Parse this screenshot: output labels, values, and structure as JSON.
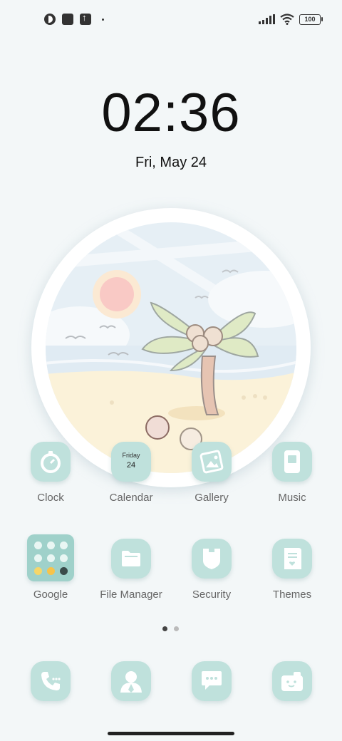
{
  "status_bar": {
    "battery": "100",
    "icons": [
      "app-indicator-icon",
      "square-app-icon",
      "upload-icon",
      "dot-icon",
      "signal-icon",
      "wifi-icon",
      "battery-icon"
    ]
  },
  "clock": {
    "time": "02:36",
    "date": "Fri, May 24"
  },
  "widget": {
    "name": "beach-scene-widget"
  },
  "apps_row1": [
    {
      "label": "Clock",
      "icon": "clock-icon"
    },
    {
      "label": "Calendar",
      "icon": "calendar-icon",
      "day_name": "Friday",
      "day_num": "24"
    },
    {
      "label": "Gallery",
      "icon": "gallery-icon"
    },
    {
      "label": "Music",
      "icon": "music-icon"
    }
  ],
  "apps_row2": [
    {
      "label": "Google",
      "icon": "google-folder-icon"
    },
    {
      "label": "File Manager",
      "icon": "folder-icon"
    },
    {
      "label": "Security",
      "icon": "shield-icon"
    },
    {
      "label": "Themes",
      "icon": "themes-icon"
    }
  ],
  "pager": {
    "pages": 2,
    "active": 0
  },
  "dock": [
    {
      "icon": "phone-icon"
    },
    {
      "icon": "contacts-icon"
    },
    {
      "icon": "messages-icon"
    },
    {
      "icon": "camera-icon"
    }
  ],
  "colors": {
    "background": "#f3f7f8",
    "icon_tint": "#bfe1dc",
    "accent": "#9fd1ca"
  }
}
